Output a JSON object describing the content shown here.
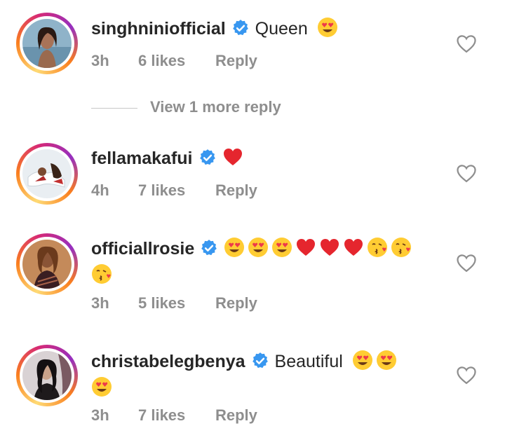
{
  "comments": [
    {
      "username": "singhniniofficial",
      "verified": true,
      "text": "Queen",
      "emojis": [
        "heart-eyes"
      ],
      "time": "3h",
      "likes": "6 likes",
      "reply_label": "Reply",
      "avatar": "woman-portrait-avatar"
    },
    {
      "username": "fellamakafui",
      "verified": true,
      "text": "",
      "emojis": [
        "red-heart"
      ],
      "time": "4h",
      "likes": "7 likes",
      "reply_label": "Reply",
      "avatar": "couple-photo-avatar"
    },
    {
      "username": "officiallrosie",
      "verified": true,
      "text": "",
      "emojis": [
        "heart-eyes",
        "heart-eyes",
        "heart-eyes",
        "red-heart",
        "red-heart",
        "red-heart",
        "kissing-heart",
        "kissing-heart",
        "kissing-heart"
      ],
      "time": "3h",
      "likes": "5 likes",
      "reply_label": "Reply",
      "avatar": "woman-portrait-avatar"
    },
    {
      "username": "christabelegbenya",
      "verified": true,
      "text": "Beautiful",
      "emojis": [
        "heart-eyes",
        "heart-eyes",
        "heart-eyes"
      ],
      "time": "3h",
      "likes": "7 likes",
      "reply_label": "Reply",
      "avatar": "woman-portrait-avatar"
    }
  ],
  "view_more_replies": "View 1 more reply",
  "colors": {
    "text": "#262626",
    "secondary": "#8e8e8e",
    "verified": "#3897f0",
    "heart": "#ed4956"
  }
}
